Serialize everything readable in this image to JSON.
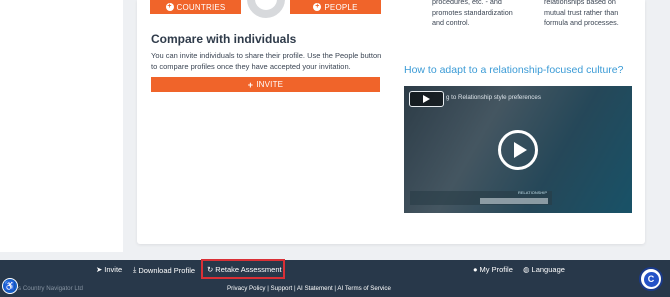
{
  "top_buttons": {
    "countries_label": "COUNTRIES",
    "people_label": "PEOPLE"
  },
  "compare": {
    "title": "Compare with individuals",
    "description": "You can invite individuals to share their profile. Use the People button to compare profiles once they have accepted your invitation.",
    "invite_label": "INVITE"
  },
  "columns": {
    "left_text": "procedures, etc. - and promotes standardization and control.",
    "right_text": "relationships based on mutual trust rather than formula and processes."
  },
  "video": {
    "title": "How to adapt to a relationship-focused culture?",
    "caption": "g to Relationship style preferences",
    "bar_label": "RELATIONSHIP"
  },
  "footer": {
    "invite_label": "Invite",
    "download_label": "Download Profile",
    "retake_label": "Retake Assessment",
    "profile_label": "My Profile",
    "language_label": "Language",
    "copyright": "s Country Navigator Ltd",
    "legal": "Privacy Policy | Support | AI Statement | AI Terms of Service"
  },
  "colors": {
    "accent_orange": "#f0642a",
    "link_blue": "#3b9bd6",
    "footer_bg": "#28384a",
    "highlight_red": "#d93036"
  },
  "icons": {
    "countries": "plus-circle-icon",
    "people": "plus-circle-icon",
    "invite": "plus-icon",
    "footer_invite": "paper-plane-icon",
    "download": "download-icon",
    "retake": "refresh-icon",
    "profile": "user-icon",
    "language": "globe-icon",
    "accessibility": "accessibility-icon",
    "chat": "chat-bot-icon"
  }
}
